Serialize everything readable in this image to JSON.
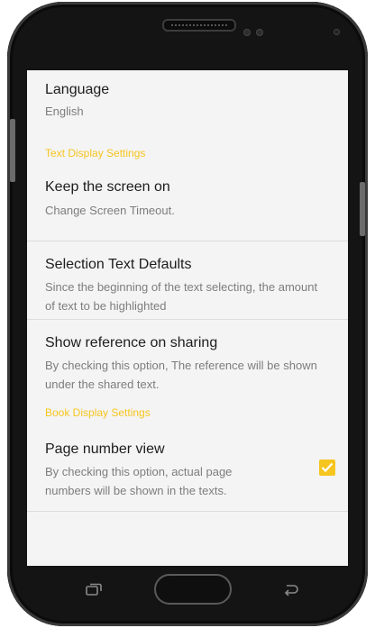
{
  "settings": {
    "language": {
      "title": "Language",
      "summary": "English"
    },
    "text_display_header": "Text Display Settings",
    "keep_screen_on": {
      "title": "Keep the screen on",
      "summary": "Change Screen Timeout."
    },
    "selection_defaults": {
      "title": "Selection Text Defaults",
      "summary": "Since the beginning of the text selecting, the amount of text to be highlighted"
    },
    "show_reference": {
      "title": "Show reference on sharing",
      "summary": "By checking this option, The reference will be shown under the shared text."
    },
    "book_display_header": "Book Display Settings",
    "page_number_view": {
      "title": "Page number view",
      "summary": "By checking this option, actual page numbers will be shown in the texts.",
      "checked": true
    }
  },
  "colors": {
    "accent": "#f6c51f",
    "screen_bg": "#f4f4f4",
    "frame": "#141414"
  },
  "icons": [
    "recent-apps-icon",
    "home-button",
    "back-icon",
    "check-icon"
  ]
}
